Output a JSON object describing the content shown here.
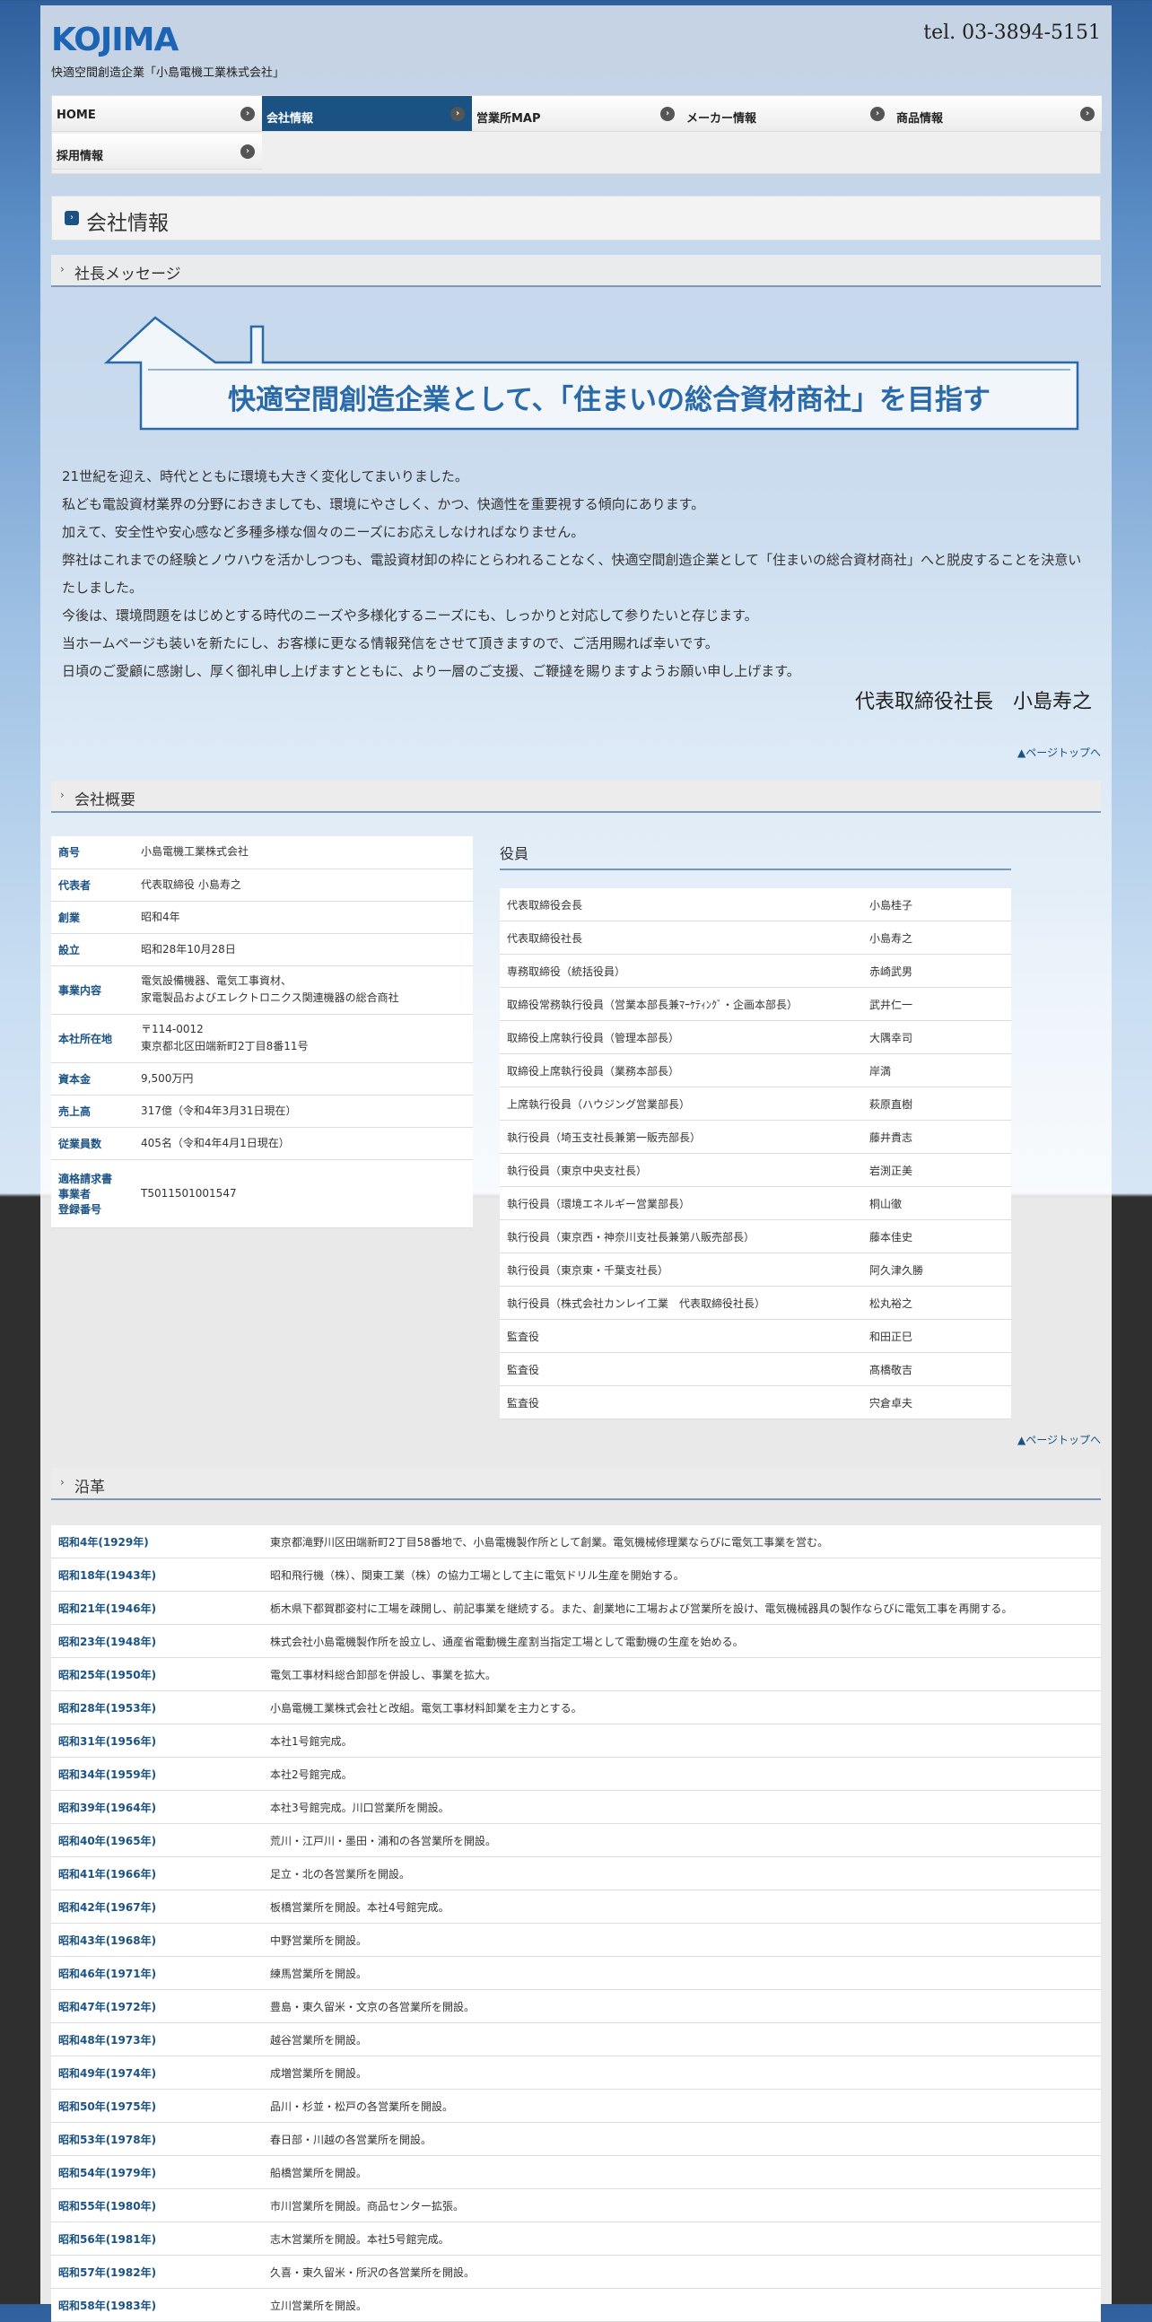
{
  "header": {
    "logo": "KOJIMA",
    "tagline": "快適空間創造企業「小島電機工業株式会社」",
    "tel": "tel. 03-3894-5151"
  },
  "nav": [
    {
      "label": "HOME",
      "active": false
    },
    {
      "label": "会社情報",
      "active": true
    },
    {
      "label": "営業所MAP",
      "active": false
    },
    {
      "label": "メーカー情報",
      "active": false
    },
    {
      "label": "商品情報",
      "active": false
    },
    {
      "label": "採用情報",
      "active": false
    }
  ],
  "page_title": "会社情報",
  "message": {
    "heading": "社長メッセージ",
    "banner": "快適空間創造企業として、「住まいの総合資材商社」を目指す",
    "paragraphs": [
      "21世紀を迎え、時代とともに環境も大きく変化してまいりました。",
      "私ども電設資材業界の分野におきましても、環境にやさしく、かつ、快適性を重要視する傾向にあります。",
      "加えて、安全性や安心感など多種多様な個々のニーズにお応えしなければなりません。",
      "弊社はこれまでの経験とノウハウを活かしつつも、電設資材卸の枠にとらわれることなく、快適空間創造企業として「住まいの総合資材商社」へと脱皮することを決意いたしました。",
      "今後は、環境問題をはじめとする時代のニーズや多様化するニーズにも、しっかりと対応して参りたいと存じます。",
      "当ホームページも装いを新たにし、お客様に更なる情報発信をさせて頂きますので、ご活用賜れば幸いです。",
      "日頃のご愛顧に感謝し、厚く御礼申し上げますとともに、より一層のご支援、ご鞭撻を賜りますようお願い申し上げます。"
    ],
    "signature": "代表取締役社長　小島寿之"
  },
  "pagetop": "▲ページトップへ",
  "overview": {
    "heading": "会社概要",
    "rows": [
      {
        "key": "商号",
        "value": "小島電機工業株式会社"
      },
      {
        "key": "代表者",
        "value": "代表取締役 小島寿之"
      },
      {
        "key": "創業",
        "value": "昭和4年"
      },
      {
        "key": "設立",
        "value": "昭和28年10月28日"
      },
      {
        "key": "事業内容",
        "value": "電気設備機器、電気工事資材、\n家電製品およびエレクトロニクス関連機器の総合商社"
      },
      {
        "key": "本社所在地",
        "value": "〒114-0012\n東京都北区田端新町2丁目8番11号"
      },
      {
        "key": "資本金",
        "value": "9,500万円"
      },
      {
        "key": "売上高",
        "value": "317億（令和4年3月31日現在）"
      },
      {
        "key": "従業員数",
        "value": "405名（令和4年4月1日現在）"
      },
      {
        "key": "適格請求書\n事業者\n登録番号",
        "value": "T5011501001547"
      }
    ]
  },
  "officers": {
    "heading": "役員",
    "rows": [
      {
        "title": "代表取締役会長",
        "name": "小島桂子"
      },
      {
        "title": "代表取締役社長",
        "name": "小島寿之"
      },
      {
        "title": "専務取締役（統括役員）",
        "name": "赤崎武男"
      },
      {
        "title": "取締役常務執行役員（営業本部長兼ﾏｰｹﾃｨﾝｸﾞ・企画本部長）",
        "name": "武井仁一"
      },
      {
        "title": "取締役上席執行役員（管理本部長）",
        "name": "大隅幸司"
      },
      {
        "title": "取締役上席執行役員（業務本部長）",
        "name": "岸満"
      },
      {
        "title": "上席執行役員（ハウジング営業部長）",
        "name": "萩原直樹"
      },
      {
        "title": "執行役員（埼玉支社長兼第一販売部長）",
        "name": "藤井貴志"
      },
      {
        "title": "執行役員（東京中央支社長）",
        "name": "岩渕正美"
      },
      {
        "title": "執行役員（環境エネルギー営業部長）",
        "name": "桐山徹"
      },
      {
        "title": "執行役員（東京西・神奈川支社長兼第八販売部長）",
        "name": "藤本佳史"
      },
      {
        "title": "執行役員（東京東・千葉支社長）",
        "name": "阿久津久勝"
      },
      {
        "title": "執行役員（株式会社カンレイ工業　代表取締役社長）",
        "name": "松丸裕之"
      },
      {
        "title": "監査役",
        "name": "和田正巳"
      },
      {
        "title": "監査役",
        "name": "髙橋敬吉"
      },
      {
        "title": "監査役",
        "name": "宍倉卓夫"
      }
    ]
  },
  "history": {
    "heading": "沿革",
    "rows": [
      {
        "year": "昭和4年(1929年)",
        "event": "東京都滝野川区田端新町2丁目58番地で、小島電機製作所として創業。電気機械修理業ならびに電気工事業を営む。"
      },
      {
        "year": "昭和18年(1943年)",
        "event": "昭和飛行機（株）、関東工業（株）の協力工場として主に電気ドリル生産を開始する。"
      },
      {
        "year": "昭和21年(1946年)",
        "event": "栃木県下都賀郡姿村に工場を疎開し、前記事業を継続する。また、創業地に工場および営業所を設け、電気機械器具の製作ならびに電気工事を再開する。"
      },
      {
        "year": "昭和23年(1948年)",
        "event": "株式会社小島電機製作所を設立し、通産省電動機生産割当指定工場として電動機の生産を始める。"
      },
      {
        "year": "昭和25年(1950年)",
        "event": "電気工事材料総合卸部を併設し、事業を拡大。"
      },
      {
        "year": "昭和28年(1953年)",
        "event": "小島電機工業株式会社と改組。電気工事材料卸業を主力とする。"
      },
      {
        "year": "昭和31年(1956年)",
        "event": "本社1号館完成。"
      },
      {
        "year": "昭和34年(1959年)",
        "event": "本社2号館完成。"
      },
      {
        "year": "昭和39年(1964年)",
        "event": "本社3号館完成。川口営業所を開設。"
      },
      {
        "year": "昭和40年(1965年)",
        "event": "荒川・江戸川・墨田・浦和の各営業所を開設。"
      },
      {
        "year": "昭和41年(1966年)",
        "event": "足立・北の各営業所を開設。"
      },
      {
        "year": "昭和42年(1967年)",
        "event": "板橋営業所を開設。本社4号館完成。"
      },
      {
        "year": "昭和43年(1968年)",
        "event": "中野営業所を開設。"
      },
      {
        "year": "昭和46年(1971年)",
        "event": "練馬営業所を開設。"
      },
      {
        "year": "昭和47年(1972年)",
        "event": "豊島・東久留米・文京の各営業所を開設。"
      },
      {
        "year": "昭和48年(1973年)",
        "event": "越谷営業所を開設。"
      },
      {
        "year": "昭和49年(1974年)",
        "event": "成増営業所を開設。"
      },
      {
        "year": "昭和50年(1975年)",
        "event": "品川・杉並・松戸の各営業所を開設。"
      },
      {
        "year": "昭和53年(1978年)",
        "event": "春日部・川越の各営業所を開設。"
      },
      {
        "year": "昭和54年(1979年)",
        "event": "船橋営業所を開設。"
      },
      {
        "year": "昭和55年(1980年)",
        "event": "市川営業所を開設。商品センター拡張。"
      },
      {
        "year": "昭和56年(1981年)",
        "event": "志木営業所を開設。本社5号館完成。"
      },
      {
        "year": "昭和57年(1982年)",
        "event": "久喜・東久留米・所沢の各営業所を開設。"
      },
      {
        "year": "昭和58年(1983年)",
        "event": "立川営業所を開設。"
      }
    ]
  }
}
